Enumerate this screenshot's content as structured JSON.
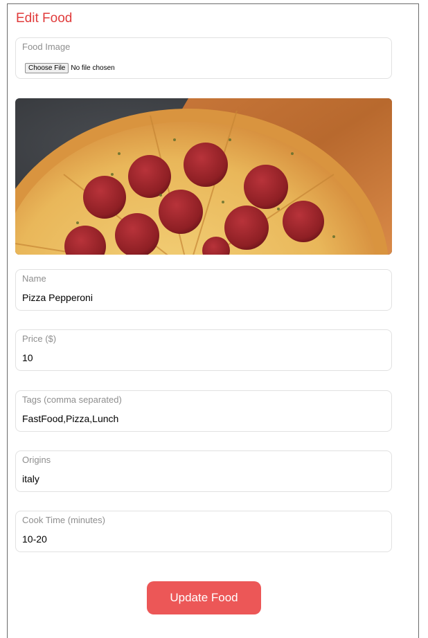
{
  "page": {
    "title": "Edit Food"
  },
  "image_field": {
    "label": "Food Image",
    "choose_file_label": "Choose File",
    "file_status": "No file chosen"
  },
  "image_preview": {
    "alt": "pizza-pepperoni-image"
  },
  "fields": {
    "name": {
      "label": "Name",
      "value": "Pizza Pepperoni"
    },
    "price": {
      "label": "Price ($)",
      "value": "10"
    },
    "tags": {
      "label": "Tags (comma separated)",
      "value": "FastFood,Pizza,Lunch"
    },
    "origins": {
      "label": "Origins",
      "value": "italy"
    },
    "cook_time": {
      "label": "Cook Time (minutes)",
      "value": "10-20"
    }
  },
  "submit": {
    "label": "Update Food"
  },
  "colors": {
    "accent": "#e03b3b",
    "button": "#ec5757",
    "field_border": "#e1e1e1",
    "label_text": "#8e8e8e"
  }
}
